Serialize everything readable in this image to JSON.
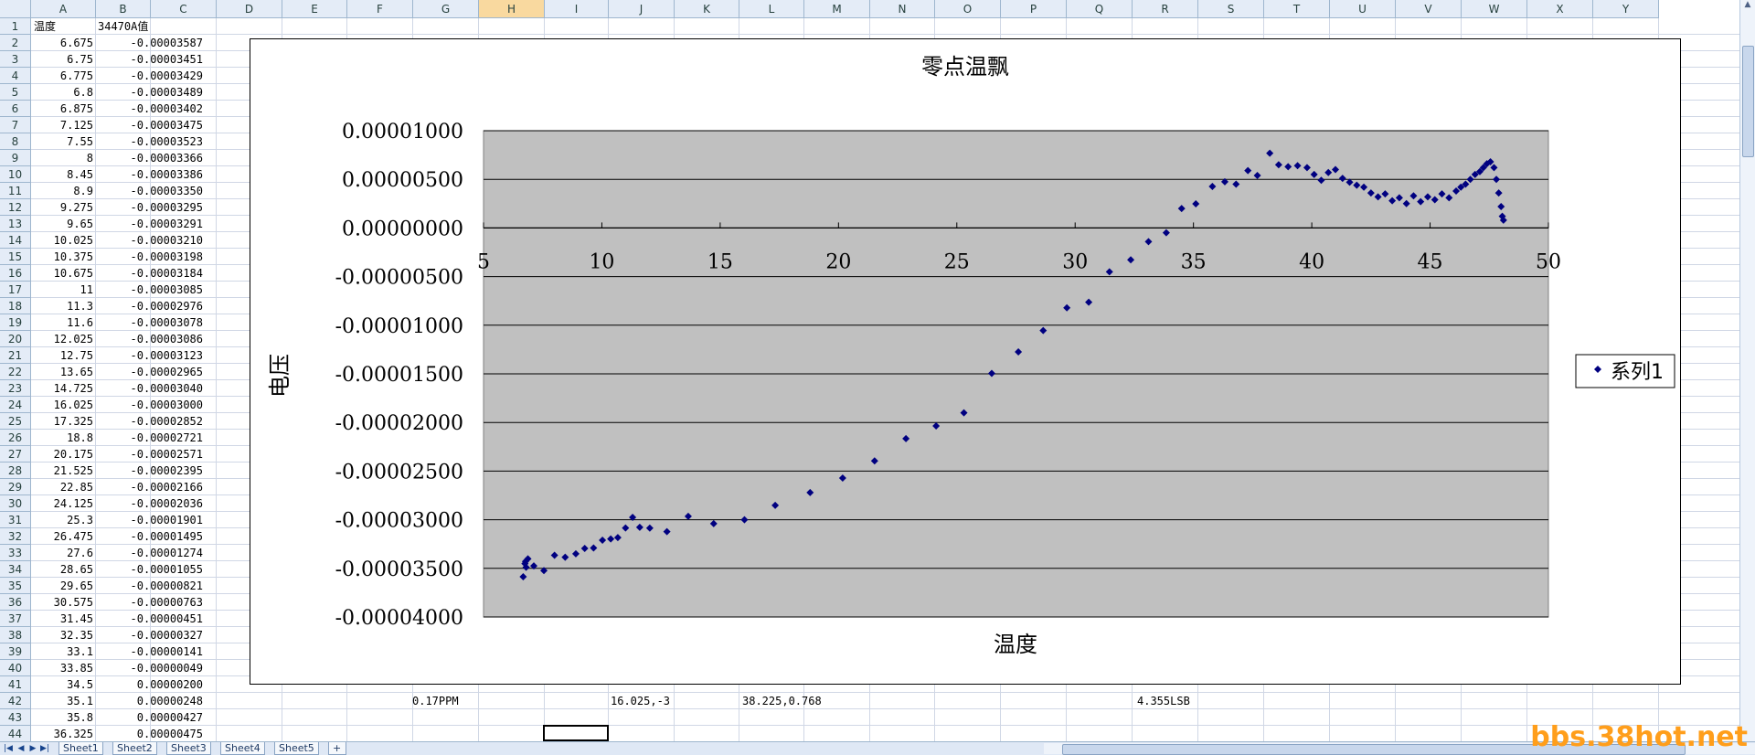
{
  "columns": [
    "A",
    "B",
    "C",
    "D",
    "E",
    "F",
    "G",
    "H",
    "I",
    "J",
    "K",
    "L",
    "M",
    "N",
    "O",
    "P",
    "Q",
    "R",
    "S",
    "T",
    "U",
    "V",
    "W",
    "X",
    "Y"
  ],
  "selected_column": "H",
  "row_numbers": [
    "1",
    "2",
    "3",
    "4",
    "5",
    "6",
    "7",
    "8",
    "9",
    "10",
    "11",
    "12",
    "13",
    "14",
    "15",
    "16",
    "17",
    "18",
    "19",
    "20",
    "21",
    "22",
    "23",
    "24",
    "25",
    "26",
    "27",
    "28",
    "29",
    "30",
    "31",
    "32",
    "33",
    "34",
    "35",
    "36",
    "37",
    "38",
    "39",
    "40",
    "41",
    "42",
    "43",
    "44"
  ],
  "sheet": {
    "header_a": "温度",
    "header_b": "34470A值",
    "rows": [
      [
        "6.675",
        "-0.00003587"
      ],
      [
        "6.75",
        "-0.00003451"
      ],
      [
        "6.775",
        "-0.00003429"
      ],
      [
        "6.8",
        "-0.00003489"
      ],
      [
        "6.875",
        "-0.00003402"
      ],
      [
        "7.125",
        "-0.00003475"
      ],
      [
        "7.55",
        "-0.00003523"
      ],
      [
        "8",
        "-0.00003366"
      ],
      [
        "8.45",
        "-0.00003386"
      ],
      [
        "8.9",
        "-0.00003350"
      ],
      [
        "9.275",
        "-0.00003295"
      ],
      [
        "9.65",
        "-0.00003291"
      ],
      [
        "10.025",
        "-0.00003210"
      ],
      [
        "10.375",
        "-0.00003198"
      ],
      [
        "10.675",
        "-0.00003184"
      ],
      [
        "11",
        "-0.00003085"
      ],
      [
        "11.3",
        "-0.00002976"
      ],
      [
        "11.6",
        "-0.00003078"
      ],
      [
        "12.025",
        "-0.00003086"
      ],
      [
        "12.75",
        "-0.00003123"
      ],
      [
        "13.65",
        "-0.00002965"
      ],
      [
        "14.725",
        "-0.00003040"
      ],
      [
        "16.025",
        "-0.00003000"
      ],
      [
        "17.325",
        "-0.00002852"
      ],
      [
        "18.8",
        "-0.00002721"
      ],
      [
        "20.175",
        "-0.00002571"
      ],
      [
        "21.525",
        "-0.00002395"
      ],
      [
        "22.85",
        "-0.00002166"
      ],
      [
        "24.125",
        "-0.00002036"
      ],
      [
        "25.3",
        "-0.00001901"
      ],
      [
        "26.475",
        "-0.00001495"
      ],
      [
        "27.6",
        "-0.00001274"
      ],
      [
        "28.65",
        "-0.00001055"
      ],
      [
        "29.65",
        "-0.00000821"
      ],
      [
        "30.575",
        "-0.00000763"
      ],
      [
        "31.45",
        "-0.00000451"
      ],
      [
        "32.35",
        "-0.00000327"
      ],
      [
        "33.1",
        "-0.00000141"
      ],
      [
        "33.85",
        "-0.00000049"
      ],
      [
        "34.5",
        "0.00000200"
      ],
      [
        "35.1",
        "0.00000248"
      ],
      [
        "35.8",
        "0.00000427"
      ],
      [
        "36.325",
        "0.00000475"
      ]
    ],
    "row42_f": "0.17PPM",
    "row42_i": "16.025,-3",
    "row42_k": "38.225,0.768",
    "row42_q": "4.355LSB"
  },
  "chart_data": {
    "type": "scatter",
    "title": "零点温飘",
    "xlabel": "温度",
    "ylabel": "电压",
    "xlim": [
      5,
      50
    ],
    "ylim": [
      -4e-05,
      1e-05
    ],
    "x_ticks": [
      "5",
      "10",
      "15",
      "20",
      "25",
      "30",
      "35",
      "40",
      "45",
      "50"
    ],
    "y_ticks": [
      "0.00001000",
      "0.00000500",
      "0.00000000",
      "-0.00000500",
      "-0.00001000",
      "-0.00001500",
      "-0.00002000",
      "-0.00002500",
      "-0.00003000",
      "-0.00003500",
      "-0.00004000"
    ],
    "legend_position": "right",
    "grid": true,
    "series": [
      {
        "name": "系列1",
        "color": "#000080",
        "x": [
          6.675,
          6.75,
          6.775,
          6.8,
          6.875,
          7.125,
          7.55,
          8,
          8.45,
          8.9,
          9.275,
          9.65,
          10.025,
          10.375,
          10.675,
          11,
          11.3,
          11.6,
          12.025,
          12.75,
          13.65,
          14.725,
          16.025,
          17.325,
          18.8,
          20.175,
          21.525,
          22.85,
          24.125,
          25.3,
          26.475,
          27.6,
          28.65,
          29.65,
          30.575,
          31.45,
          32.35,
          33.1,
          33.85,
          34.5,
          35.1,
          35.8,
          36.325,
          36.8,
          37.3,
          37.7,
          38.225,
          38.6,
          39,
          39.4,
          39.8,
          40.1,
          40.4,
          40.7,
          41,
          41.3,
          41.6,
          41.9,
          42.2,
          42.5,
          42.8,
          43.1,
          43.4,
          43.7,
          44,
          44.3,
          44.6,
          44.9,
          45.2,
          45.5,
          45.8,
          46.1,
          46.3,
          46.5,
          46.7,
          46.9,
          47.1,
          47.25,
          47.4,
          47.55,
          47.7,
          47.8,
          47.9,
          48,
          48.05,
          48.1
        ],
        "y": [
          -3.587e-05,
          -3.451e-05,
          -3.429e-05,
          -3.489e-05,
          -3.402e-05,
          -3.475e-05,
          -3.523e-05,
          -3.366e-05,
          -3.386e-05,
          -3.35e-05,
          -3.295e-05,
          -3.291e-05,
          -3.21e-05,
          -3.198e-05,
          -3.184e-05,
          -3.085e-05,
          -2.976e-05,
          -3.078e-05,
          -3.086e-05,
          -3.123e-05,
          -2.965e-05,
          -3.04e-05,
          -3e-05,
          -2.852e-05,
          -2.721e-05,
          -2.571e-05,
          -2.395e-05,
          -2.166e-05,
          -2.036e-05,
          -1.901e-05,
          -1.495e-05,
          -1.274e-05,
          -1.055e-05,
          -8.21e-06,
          -7.63e-06,
          -4.51e-06,
          -3.27e-06,
          -1.41e-06,
          -4.9e-07,
          2e-06,
          2.48e-06,
          4.27e-06,
          4.75e-06,
          4.5e-06,
          5.9e-06,
          5.4e-06,
          7.68e-06,
          6.5e-06,
          6.3e-06,
          6.4e-06,
          6.2e-06,
          5.5e-06,
          4.9e-06,
          5.7e-06,
          6e-06,
          5.1e-06,
          4.7e-06,
          4.4e-06,
          4.2e-06,
          3.6e-06,
          3.2e-06,
          3.5e-06,
          2.8e-06,
          3.1e-06,
          2.5e-06,
          3.3e-06,
          2.7e-06,
          3.2e-06,
          2.9e-06,
          3.5e-06,
          3.1e-06,
          3.8e-06,
          4.2e-06,
          4.5e-06,
          5e-06,
          5.5e-06,
          5.8e-06,
          6.2e-06,
          6.6e-06,
          6.8e-06,
          6.2e-06,
          5e-06,
          3.6e-06,
          2.2e-06,
          1.2e-06,
          8e-07
        ]
      }
    ]
  },
  "sheet_tabs": [
    "Sheet1",
    "Sheet2",
    "Sheet3",
    "Sheet4",
    "Sheet5"
  ],
  "watermark": "bbs.38hot.net"
}
